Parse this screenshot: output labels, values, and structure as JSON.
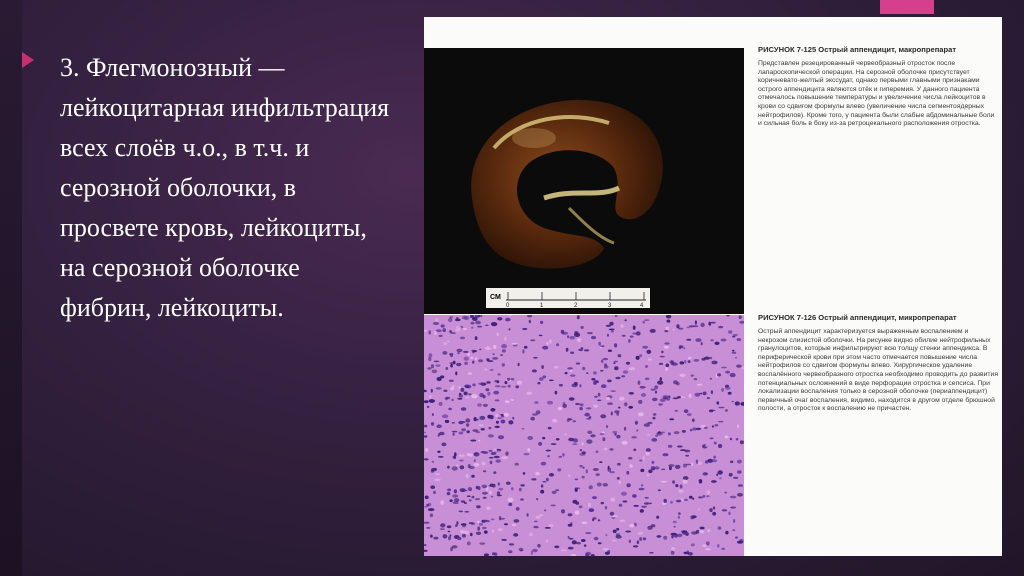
{
  "slide": {
    "text": "3. Флегмонозный — лейкоцитарная инфильтрация всех слоёв ч.о., в т.ч. и серозной оболочки, в просвете кровь, лейкоциты, на серозной оболочке фибрин, лейкоциты."
  },
  "figure": {
    "fig1_title": "РИСУНОК 7-125 Острый аппендицит, макропрепарат",
    "fig1_text": "Представлен резецированный червеобразный отросток после лапароскопической операции. На серозной оболочке присутствует коричневато-желтый экссудат, однако первыми главными признаками острого аппендицита являются отёк и гиперемия. У данного пациента отмечалось повышение температуры и увеличение числа лейкоцитов в крови со сдвигом формулы влево (увеличение числа сегментоядерных нейтрофилов). Кроме того, у пациента были слабые абдоминальные боли и сильная боль в боку из-за ретроцекального расположения отростка.",
    "fig2_title": "РИСУНОК 7-126 Острый аппендицит, микропрепарат",
    "fig2_text": "Острый аппендицит характеризуется выраженным воспалением и некрозом слизистой оболочки. На рисунке видно обилие нейтрофильных гранулоцитов, которые инфильтрируют всю толщу стенки аппендикса. В периферической крови при этом часто отмечается повышение числа нейтрофилов со сдвигом формулы влево. Хирургическое удаление воспалённого червеобразного отростка необходимо проводить до развития потенциальных осложнений в виде перфорации отростка и сепсиса. При локализации воспаления только в серозной оболочке (периаппендицит) первичный очаг воспаления, видимо, находится в другом отделе брюшной полости, а отросток к воспалению не причастен.",
    "scale_cm": "CM",
    "scale_nums": [
      "0",
      "1",
      "2",
      "3",
      "4"
    ]
  },
  "colors": {
    "accent": "#c8316f",
    "tab": "#d63f8c"
  }
}
